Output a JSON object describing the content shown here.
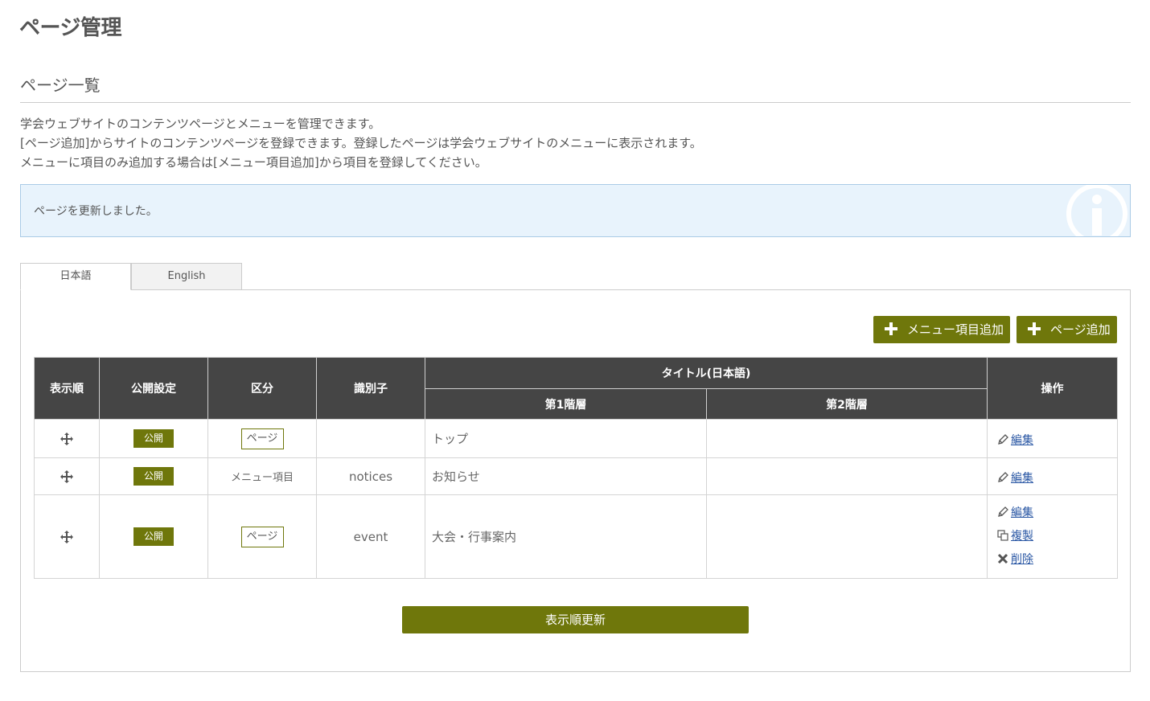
{
  "header": {
    "title": "ページ管理"
  },
  "section": {
    "title": "ページ一覧"
  },
  "description": [
    "学会ウェブサイトのコンテンツページとメニューを管理できます。",
    "[ページ追加]からサイトのコンテンツページを登録できます。登録したページは学会ウェブサイトのメニューに表示されます。",
    "メニューに項目のみ追加する場合は[メニュー項目追加]から項目を登録してください。"
  ],
  "alert": {
    "message": "ページを更新しました。",
    "icon": "info-icon",
    "color": "#e8f3fc"
  },
  "tabs": [
    {
      "label": "日本語",
      "active": true
    },
    {
      "label": "English",
      "active": false
    }
  ],
  "toolbar": {
    "add_menu_label": "メニュー項目追加",
    "add_page_label": "ページ追加"
  },
  "table": {
    "headers": {
      "order": "表示順",
      "publish": "公開設定",
      "category": "区分",
      "identifier": "識別子",
      "title": "タイトル(日本語)",
      "level1": "第1階層",
      "level2": "第2階層",
      "actions": "操作"
    },
    "rows": [
      {
        "publish": "公開",
        "category": "ページ",
        "identifier": "",
        "level1": "トップ",
        "level2": "",
        "actions": [
          "編集"
        ]
      },
      {
        "publish": "公開",
        "category": "メニュー項目",
        "identifier": "notices",
        "level1": "お知らせ",
        "level2": "",
        "actions": [
          "編集"
        ]
      },
      {
        "publish": "公開",
        "category": "ページ",
        "identifier": "event",
        "level1": "大会・行事案内",
        "level2": "",
        "actions": [
          "編集",
          "複製",
          "削除"
        ]
      }
    ]
  },
  "footer": {
    "update_order_label": "表示順更新"
  },
  "colors": {
    "accent": "#6f770b",
    "header_bg": "#454545",
    "link": "#2a57a4"
  }
}
